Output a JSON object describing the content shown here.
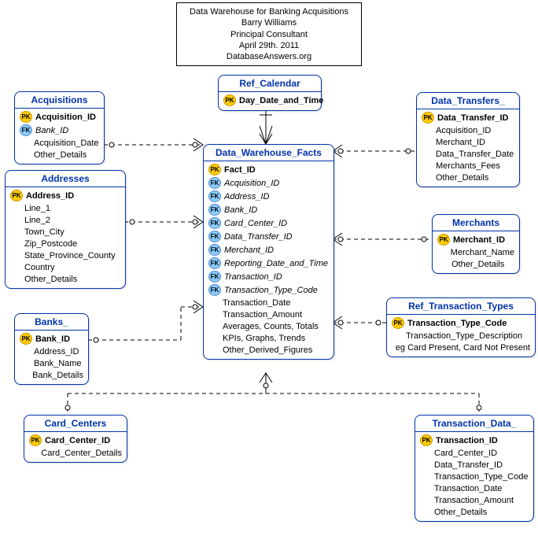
{
  "header": {
    "l1": "Data Warehouse for Banking Acquisitions",
    "l2": "Barry Williams",
    "l3": "Principal Consultant",
    "l4": "April 29th. 2011",
    "l5": "DatabaseAnswers.org"
  },
  "entities": {
    "ref_calendar": {
      "title": "Ref_Calendar",
      "cols": [
        {
          "kt": "pk",
          "name": "Day_Date_and_Time",
          "b": true
        }
      ]
    },
    "acquisitions": {
      "title": "Acquisitions",
      "cols": [
        {
          "kt": "pk",
          "name": "Acquisition_ID",
          "b": true
        },
        {
          "kt": "fk",
          "name": "Bank_ID",
          "i": true
        },
        {
          "kt": "",
          "name": "Acquisition_Date"
        },
        {
          "kt": "",
          "name": "Other_Details"
        }
      ]
    },
    "addresses": {
      "title": "Addresses",
      "cols": [
        {
          "kt": "pk",
          "name": "Address_ID",
          "b": true
        },
        {
          "kt": "",
          "name": "Line_1"
        },
        {
          "kt": "",
          "name": "Line_2"
        },
        {
          "kt": "",
          "name": "Town_City"
        },
        {
          "kt": "",
          "name": "Zip_Postcode"
        },
        {
          "kt": "",
          "name": "State_Province_County"
        },
        {
          "kt": "",
          "name": "Country"
        },
        {
          "kt": "",
          "name": "Other_Details"
        }
      ]
    },
    "banks": {
      "title": "Banks_",
      "cols": [
        {
          "kt": "pk",
          "name": "Bank_ID",
          "b": true
        },
        {
          "kt": "",
          "name": "Address_ID"
        },
        {
          "kt": "",
          "name": "Bank_Name"
        },
        {
          "kt": "",
          "name": "Bank_Details"
        }
      ]
    },
    "card_centers": {
      "title": "Card_Centers",
      "cols": [
        {
          "kt": "pk",
          "name": "Card_Center_ID",
          "b": true
        },
        {
          "kt": "",
          "name": "Card_Center_Details"
        }
      ]
    },
    "data_transfers": {
      "title": "Data_Transfers_",
      "cols": [
        {
          "kt": "pk",
          "name": "Data_Transfer_ID",
          "b": true
        },
        {
          "kt": "",
          "name": "Acquisition_ID"
        },
        {
          "kt": "",
          "name": "Merchant_ID"
        },
        {
          "kt": "",
          "name": "Data_Transfer_Date"
        },
        {
          "kt": "",
          "name": "Merchants_Fees"
        },
        {
          "kt": "",
          "name": "Other_Details"
        }
      ]
    },
    "merchants": {
      "title": "Merchants",
      "cols": [
        {
          "kt": "pk",
          "name": "Merchant_ID",
          "b": true
        },
        {
          "kt": "",
          "name": "Merchant_Name"
        },
        {
          "kt": "",
          "name": "Other_Details"
        }
      ]
    },
    "ref_txn_types": {
      "title": "Ref_Transaction_Types",
      "cols": [
        {
          "kt": "pk",
          "name": "Transaction_Type_Code",
          "b": true
        },
        {
          "kt": "",
          "name": "Transaction_Type_Description"
        },
        {
          "kt": "",
          "name": "eg Card Present, Card Not Present"
        }
      ]
    },
    "transaction_data": {
      "title": "Transaction_Data_",
      "cols": [
        {
          "kt": "pk",
          "name": "Transaction_ID",
          "b": true
        },
        {
          "kt": "",
          "name": "Card_Center_ID"
        },
        {
          "kt": "",
          "name": "Data_Transfer_ID"
        },
        {
          "kt": "",
          "name": "Transaction_Type_Code"
        },
        {
          "kt": "",
          "name": "Transaction_Date"
        },
        {
          "kt": "",
          "name": "Transaction_Amount"
        },
        {
          "kt": "",
          "name": "Other_Details"
        }
      ]
    },
    "facts": {
      "title": "Data_Warehouse_Facts",
      "cols": [
        {
          "kt": "pk",
          "name": "Fact_ID",
          "b": true
        },
        {
          "kt": "fk",
          "name": "Acquisition_ID",
          "i": true
        },
        {
          "kt": "fk",
          "name": "Address_ID",
          "i": true
        },
        {
          "kt": "fk",
          "name": "Bank_ID",
          "i": true
        },
        {
          "kt": "fk",
          "name": "Card_Center_ID",
          "i": true
        },
        {
          "kt": "fk",
          "name": "Data_Transfer_ID",
          "i": true
        },
        {
          "kt": "fk",
          "name": "Merchant_ID",
          "i": true
        },
        {
          "kt": "fk",
          "name": "Reporting_Date_and_Time",
          "i": true
        },
        {
          "kt": "fk",
          "name": "Transaction_ID",
          "i": true
        },
        {
          "kt": "fk",
          "name": "Transaction_Type_Code",
          "i": true
        },
        {
          "kt": "",
          "name": "Transaction_Date"
        },
        {
          "kt": "",
          "name": "Transaction_Amount"
        },
        {
          "kt": "",
          "name": "Averages, Counts, Totals"
        },
        {
          "kt": "",
          "name": "KPIs, Graphs, Trends"
        },
        {
          "kt": "",
          "name": "Other_Derived_Figures"
        }
      ]
    }
  }
}
